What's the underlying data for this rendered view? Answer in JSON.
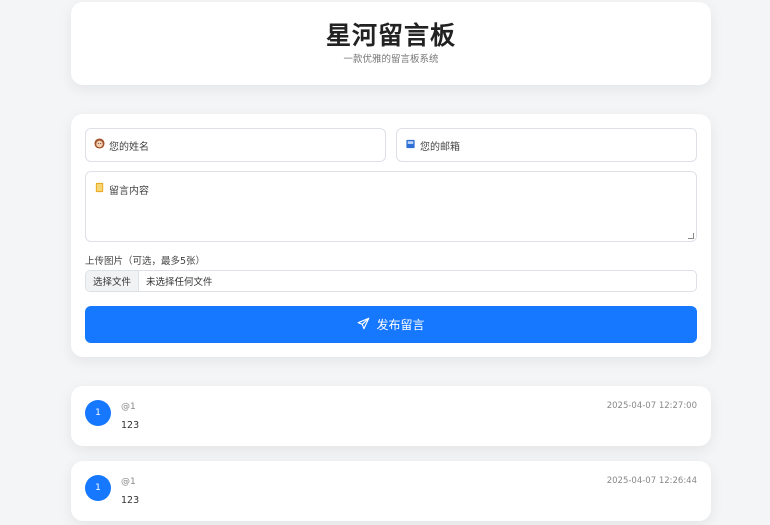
{
  "header": {
    "title": "星河留言板",
    "subtitle": "一款优雅的留言板系统"
  },
  "form": {
    "name_placeholder": "您的姓名",
    "name_icon": "person-icon",
    "email_placeholder": "您的邮箱",
    "email_icon": "mailbox-icon",
    "content_placeholder": "留言内容",
    "content_icon": "notebook-icon",
    "upload_label": "上传图片（可选，最多5张）",
    "file_button": "选择文件",
    "file_status": "未选择任何文件",
    "submit_label": "发布留言",
    "submit_icon": "send-icon"
  },
  "messages": [
    {
      "avatar": "1",
      "user": "@1",
      "time": "2025-04-07 12:27:00",
      "text": "123"
    },
    {
      "avatar": "1",
      "user": "@1",
      "time": "2025-04-07 12:26:44",
      "text": "123"
    }
  ],
  "colors": {
    "accent": "#1677ff",
    "background": "#f4f5f7"
  }
}
